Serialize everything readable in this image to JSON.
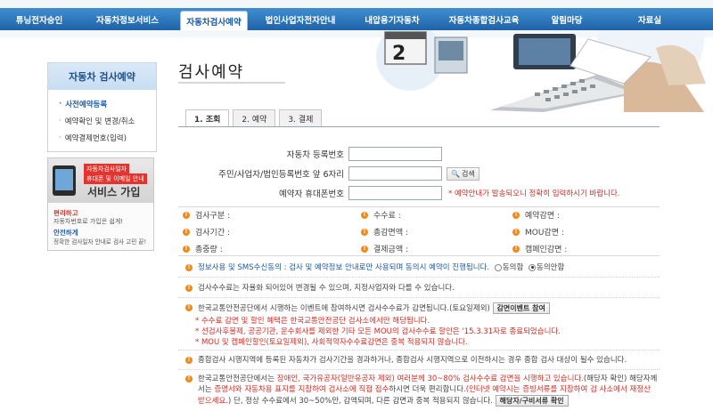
{
  "nav": {
    "items": [
      {
        "label": "튜닝전자승인"
      },
      {
        "label": "자동차정보서비스"
      },
      {
        "label": "자동차검사예약"
      },
      {
        "label": "법인사업자전자안내"
      },
      {
        "label": "내압용기자동차"
      },
      {
        "label": "자동차종합검사교육"
      },
      {
        "label": "알림마당"
      },
      {
        "label": "자료실"
      }
    ],
    "active_index": 2
  },
  "sidebar": {
    "title": "자동차 검사예약",
    "items": [
      {
        "label": "사전예약등록"
      },
      {
        "label": "예약확인 및 변경/취소"
      },
      {
        "label": "예약결제번호(입력)"
      }
    ]
  },
  "banner": {
    "tag1": "자동차검사일자",
    "tag2": "휴대폰 및 이메일 안내",
    "title": "서비스 가입",
    "line1": "편리하고",
    "line2": "자동차번호로 가입은 쉽게!",
    "line3": "안전하게",
    "line4": "정확한 검사일자 안내로 검사 고민 끝!"
  },
  "page": {
    "title": "검사예약"
  },
  "tabs": [
    {
      "label": "1. 조회"
    },
    {
      "label": "2. 예약"
    },
    {
      "label": "3. 결제"
    }
  ],
  "form": {
    "reg_label": "자동차 등록번호",
    "reg_value": "",
    "id_label": "주민/사업자/법인등록번호 앞 6자리",
    "id_value": "",
    "search_label": "검색",
    "phone_label": "예약자 휴대폰번호",
    "phone_value": "",
    "phone_note": "* 예약안내가 발송되오니 정확히 입력하시기 바랍니다."
  },
  "info": {
    "r1": [
      "검사구분 :",
      "수수료 :",
      "예약감면 :"
    ],
    "r2": [
      "검사기간 :",
      "총감면액 :",
      "MOU감면 :"
    ],
    "r3": [
      "총중량 :",
      "결제금액 :",
      "캠페인감면 :"
    ]
  },
  "consent": {
    "text": "정보사용 및 SMS수신동의 : 검사 및 예약정보 안내로만 사용되며 동의시 예약이 진행됩니다.",
    "agree": "동의함",
    "disagree": "동의안함"
  },
  "notes": {
    "p1": "검사수수료는 자율화 되어있어 변경될 수 있으며, 지정사업자와 다를 수 있습니다.",
    "p2a": "한국교통안전공단에서 시행하는 이벤트에 참여하시면 검사수수료가 감면됩니다.(토요일제외)",
    "p2btn": "감면이벤트 참여",
    "s1": "* 수수료 감면 및 할인 혜택은 한국교통안전공단 검사소에서만 해당됩니다.",
    "s2": "* 선검사후불제, 공공기관, 운수회사를 제외한 기타 모든 MOU의 검사수수료 할인은 '15.3.31자로 종료되었습니다.",
    "s3": "* MOU 및 캠페인할인(토요일제외), 사회적약자수수료감면은 중복 적용되지 않습니다.",
    "p3": "종합검사 시행지역에 등록된 자동차가 검사기간을 경과하거나, 종합검사 시행지역으로 이전하시는 경우 종합 검사 대상이 될수 있습니다.",
    "p4a": "한국교통안전공단에서는",
    "p4b": "장애인, 국가유공자(일반유공자 제외) 여러분께 30~80% 검사수수료 감면을 시행하고 있습니다.",
    "p4c": "(해당자 확인)",
    "p4d": "해당자께서는",
    "p4e": "증명서와 자동차용 표지를 지참하여 검사소에 직접 접수",
    "p4f": "하시면 더욱 편리합니다.",
    "p4g": "(인터넷 예약시는 증빙서류를 지참하여 검",
    "p4h": "사소에서 재정산 받으세요.",
    "p4i": ") 단, 정상 수수료에서 30~50%만, 감액되며, 다른 감면과 중복 적용되지 않습니다.",
    "p4btn": "해당자/구비서류 확인"
  }
}
